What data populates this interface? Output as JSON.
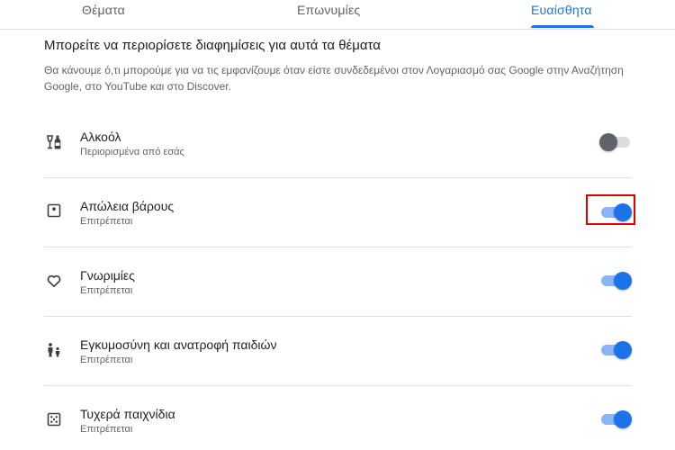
{
  "tabs": [
    {
      "label": "Θέματα",
      "selected": false
    },
    {
      "label": "Επωνυμίες",
      "selected": false
    },
    {
      "label": "Ευαίσθητα",
      "selected": true
    }
  ],
  "colors": {
    "accent": "#1a73e8",
    "highlight_box": "#e00000"
  },
  "heading": "Μπορείτε να περιορίσετε διαφημίσεις για αυτά τα θέματα",
  "description": "Θα κάνουμε ό,τι μπορούμε για να τις εμφανίζουμε όταν είστε συνδεδεμένοι στον Λογαριασμό σας Google στην Αναζήτηση Google, στο YouTube και στο Discover.",
  "topics": [
    {
      "title": "Αλκοόλ",
      "status": "Περιορισμένα από εσάς",
      "enabled": false,
      "icon": "alcohol-icon"
    },
    {
      "title": "Απώλεια βάρους",
      "status": "Επιτρέπεται",
      "enabled": true,
      "icon": "scale-icon"
    },
    {
      "title": "Γνωριμίες",
      "status": "Επιτρέπεται",
      "enabled": true,
      "icon": "heart-icon"
    },
    {
      "title": "Εγκυμοσύνη και ανατροφή παιδιών",
      "status": "Επιτρέπεται",
      "enabled": true,
      "icon": "parent-child-icon"
    },
    {
      "title": "Τυχερά παιχνίδια",
      "status": "Επιτρέπεται",
      "enabled": true,
      "icon": "dice-icon"
    }
  ]
}
